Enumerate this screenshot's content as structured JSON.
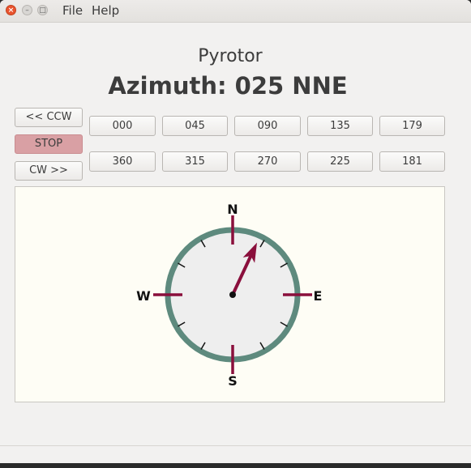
{
  "window": {
    "controls": {
      "close_glyph": "×",
      "min_glyph": "–",
      "max_glyph": "□"
    }
  },
  "menu": {
    "items": [
      "File",
      "Help"
    ]
  },
  "app": {
    "title": "Pyrotor",
    "azimuth_label": "Azimuth: 025 NNE",
    "azimuth_degrees": 25
  },
  "controls": {
    "ccw_label": "<< CCW",
    "stop_label": "STOP",
    "cw_label": "CW >>",
    "preset_row1": [
      "000",
      "045",
      "090",
      "135",
      "179"
    ],
    "preset_row2": [
      "360",
      "315",
      "270",
      "225",
      "181"
    ]
  },
  "compass": {
    "labels": {
      "n": "N",
      "e": "E",
      "s": "S",
      "w": "W"
    },
    "colors": {
      "ring": "#5e8a7e",
      "face": "#eeeeee",
      "needle": "#8a0f3c",
      "cardinal_tick": "#8a0f3c",
      "minor_tick": "#111111",
      "canvas_bg": "#fefdf5"
    }
  },
  "colors": {
    "stop_button": "#d9a0a4",
    "window_bg": "#f2f1f0"
  }
}
